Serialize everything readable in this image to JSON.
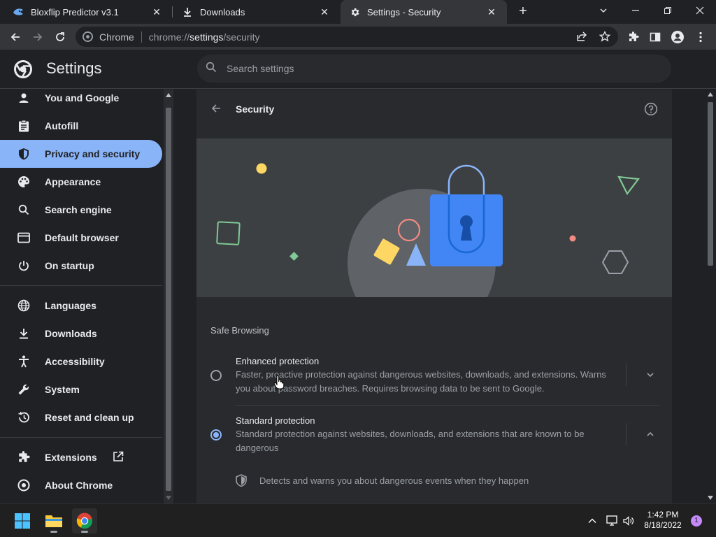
{
  "tabs": [
    {
      "label": "Bloxflip Predictor v3.1",
      "icon": "bloxflip-favicon",
      "close": "✕"
    },
    {
      "label": "Downloads",
      "icon": "download-icon",
      "close": "✕"
    },
    {
      "label": "Settings - Security",
      "icon": "gear-icon",
      "close": "✕"
    }
  ],
  "omnibox": {
    "site_label": "Chrome",
    "url_scheme": "chrome://",
    "url_host": "settings",
    "url_path": "/security"
  },
  "header": {
    "title": "Settings",
    "search_placeholder": "Search settings"
  },
  "sidebar": {
    "items": [
      {
        "label": "You and Google",
        "icon": "person-icon"
      },
      {
        "label": "Autofill",
        "icon": "clipboard-icon"
      },
      {
        "label": "Privacy and security",
        "icon": "shield-icon",
        "selected": true
      },
      {
        "label": "Appearance",
        "icon": "palette-icon"
      },
      {
        "label": "Search engine",
        "icon": "search-icon"
      },
      {
        "label": "Default browser",
        "icon": "browser-icon"
      },
      {
        "label": "On startup",
        "icon": "power-icon"
      },
      {
        "label": "Languages",
        "icon": "globe-icon"
      },
      {
        "label": "Downloads",
        "icon": "download-icon"
      },
      {
        "label": "Accessibility",
        "icon": "accessibility-icon"
      },
      {
        "label": "System",
        "icon": "wrench-icon"
      },
      {
        "label": "Reset and clean up",
        "icon": "history-icon"
      },
      {
        "label": "Extensions",
        "icon": "puzzle-icon"
      },
      {
        "label": "About Chrome",
        "icon": "chrome-icon"
      }
    ]
  },
  "page": {
    "title": "Security",
    "section_title": "Safe Browsing",
    "options": [
      {
        "title": "Enhanced protection",
        "desc": "Faster, proactive protection against dangerous websites, downloads, and extensions. Warns you about password breaches. Requires browsing data to be sent to Google.",
        "checked": false
      },
      {
        "title": "Standard protection",
        "desc": "Standard protection against websites, downloads, and extensions that are known to be dangerous",
        "checked": true
      }
    ],
    "detail": "Detects and warns you about dangerous events when they happen"
  },
  "taskbar": {
    "time": "1:42 PM",
    "date": "8/18/2022",
    "notification_count": "1"
  },
  "colors": {
    "accent": "#8ab4f8",
    "background": "#202124",
    "card": "#292a2d",
    "toolbar": "#35363a"
  }
}
